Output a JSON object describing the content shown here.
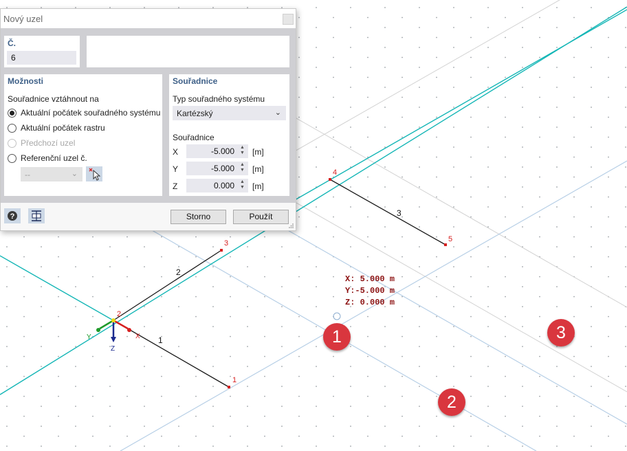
{
  "dialog": {
    "title": "Nový uzel",
    "number_panel": {
      "label": "Č.",
      "value": "6"
    },
    "options_panel": {
      "title": "Možnosti",
      "relate_label": "Souřadnice vztáhnout na",
      "options": [
        {
          "label": "Aktuální počátek souřadného systému",
          "checked": true,
          "enabled": true
        },
        {
          "label": "Aktuální počátek rastru",
          "checked": false,
          "enabled": true
        },
        {
          "label": "Předchozí uzel",
          "checked": false,
          "enabled": false
        },
        {
          "label": "Referenční uzel č.",
          "checked": false,
          "enabled": true
        }
      ],
      "reference_node_value": "--"
    },
    "coords_panel": {
      "title": "Souřadnice",
      "system_label": "Typ souřadného systému",
      "system_value": "Kartézský",
      "coords_label": "Souřadnice",
      "rows": [
        {
          "axis": "X",
          "value": "-5.000",
          "unit": "[m]"
        },
        {
          "axis": "Y",
          "value": "-5.000",
          "unit": "[m]"
        },
        {
          "axis": "Z",
          "value": "0.000",
          "unit": "[m]"
        }
      ]
    },
    "footer": {
      "cancel_label": "Storno",
      "apply_label": "Použít"
    }
  },
  "viewport": {
    "node_labels": [
      "1",
      "2",
      "3",
      "4",
      "5"
    ],
    "member_labels": [
      "1",
      "2",
      "3"
    ],
    "axis_labels": {
      "x": "X",
      "y": "Y",
      "z": "Z"
    },
    "cursor_readout": {
      "x": "X: 5.000 m",
      "y": "Y:-5.000 m",
      "z": "Z: 0.000 m"
    },
    "badges": [
      "1",
      "2",
      "3"
    ]
  },
  "colors": {
    "accent_line": "#14b6b6",
    "grid_line": "#b7cfe6",
    "node": "#d62020",
    "badge": "#d9363e",
    "panel_title": "#3d5f87"
  }
}
